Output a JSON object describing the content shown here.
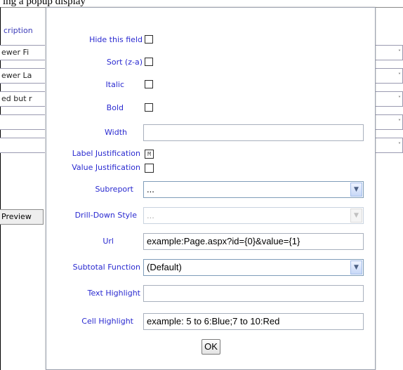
{
  "caption": {
    "text": "ing a popup display"
  },
  "background": {
    "column_header": "cription",
    "rows": [
      {
        "text": "ewer Fi"
      },
      {
        "text": "ewer La"
      },
      {
        "text": "ed but r"
      },
      {
        "text": ""
      },
      {
        "text": ""
      }
    ],
    "preview_button": "Preview"
  },
  "dialog": {
    "hide_field": {
      "label": "Hide this field",
      "checked": false
    },
    "sort": {
      "label": "Sort (z-a)",
      "checked": false
    },
    "italic": {
      "label": "Italic",
      "checked": false
    },
    "bold": {
      "label": "Bold",
      "checked": false
    },
    "width": {
      "label": "Width",
      "value": ""
    },
    "label_justification": {
      "label": "Label Justification",
      "glyph": "M"
    },
    "value_justification": {
      "label": "Value Justification",
      "glyph": ""
    },
    "subreport": {
      "label": "Subreport",
      "value": "..."
    },
    "drill_down_style": {
      "label": "Drill-Down Style",
      "value": "...",
      "disabled": true
    },
    "url": {
      "label": "Url",
      "value": "example:Page.aspx?id={0}&value={1}"
    },
    "subtotal_function": {
      "label": "Subtotal Function",
      "value": "(Default)"
    },
    "text_highlight": {
      "label": "Text Highlight",
      "value": ""
    },
    "cell_highlight": {
      "label": "Cell Highlight",
      "value": "example: 5 to 6:Blue;7 to 10:Red"
    },
    "ok_label": "OK"
  },
  "icons": {
    "dropdown_arrow": "chevron-down-icon"
  },
  "colors": {
    "label": "#2a2ad0",
    "dialog_border": "#9aa0ad",
    "select_border": "#7f9db9"
  }
}
